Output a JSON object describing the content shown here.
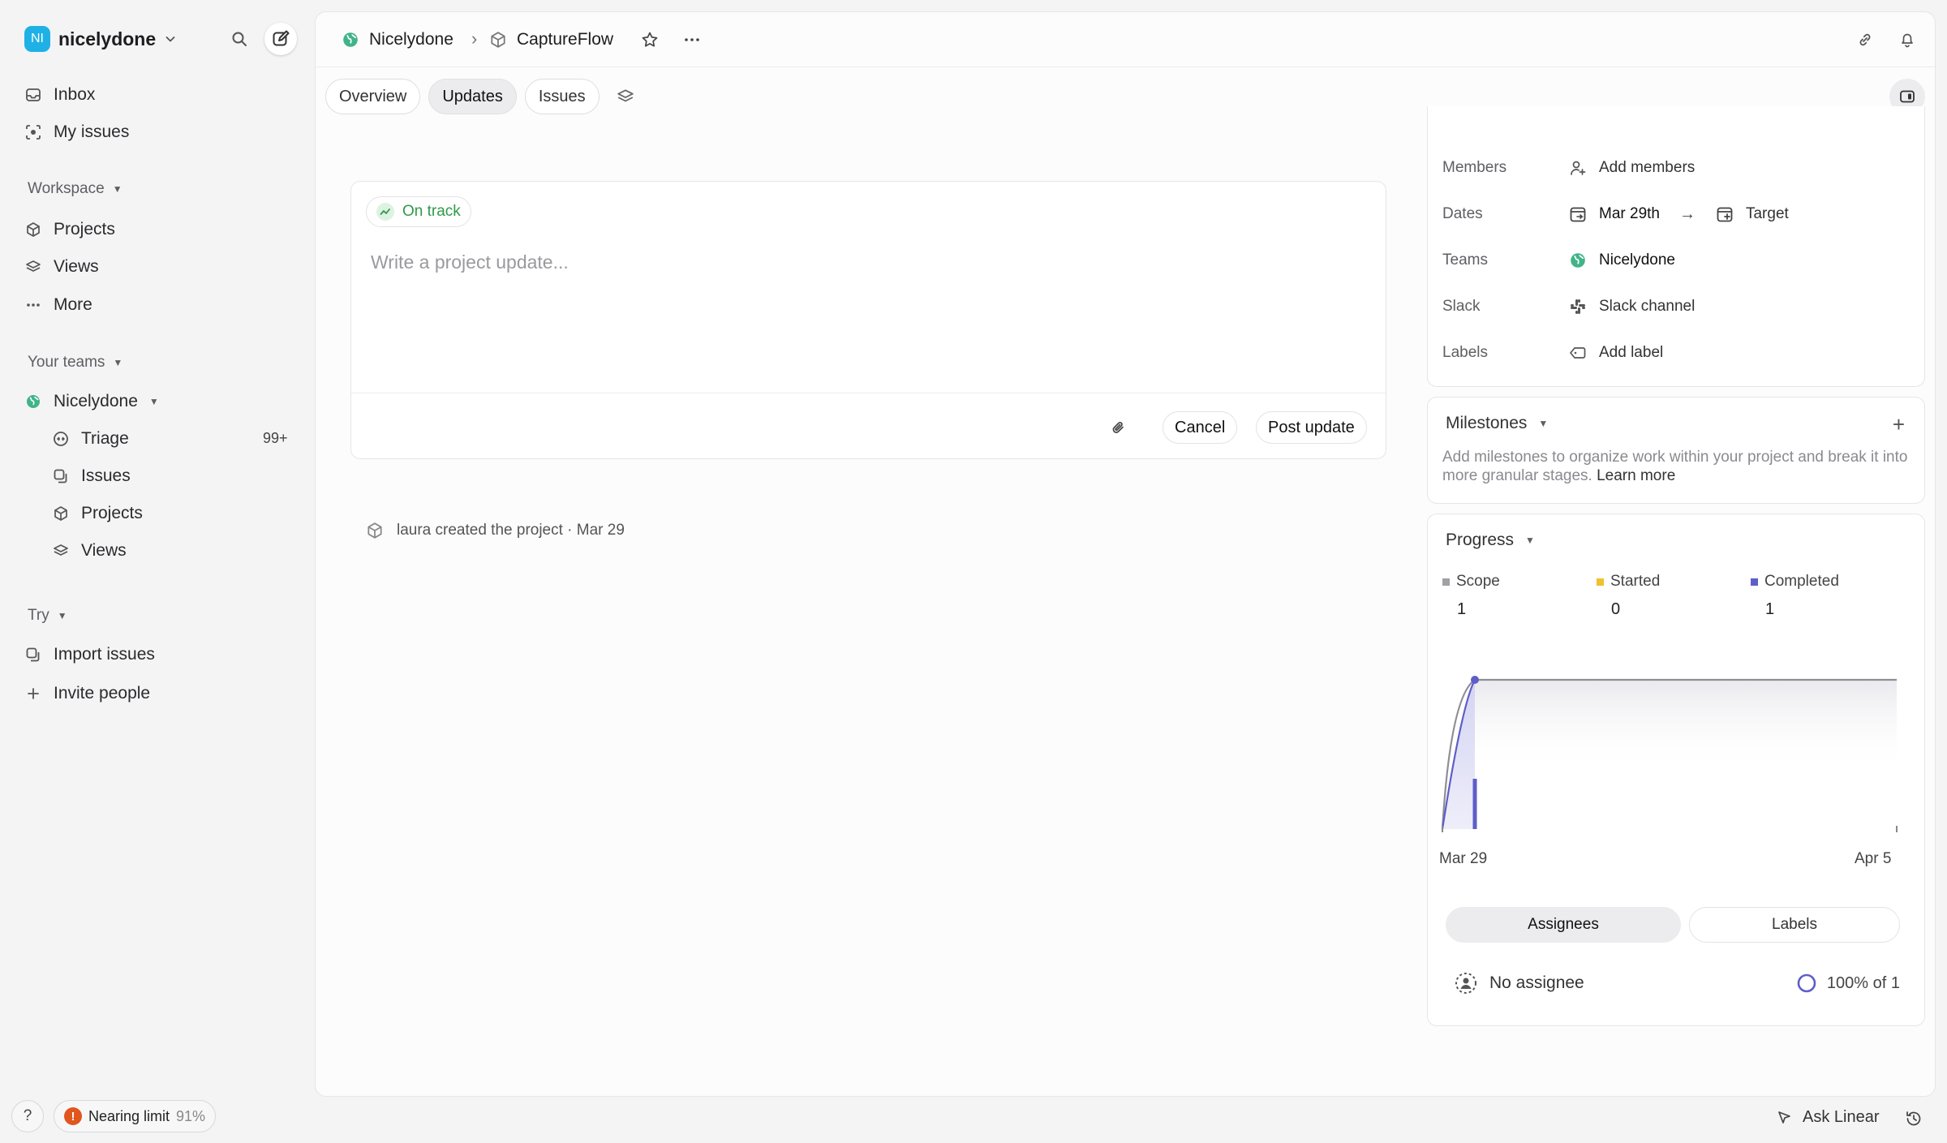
{
  "workspace": {
    "initials": "NI",
    "name": "nicelydone"
  },
  "sidebar": {
    "top": [
      {
        "label": "Inbox",
        "icon": "inbox-icon"
      },
      {
        "label": "My issues",
        "icon": "my-issues-icon"
      }
    ],
    "workspace_header": "Workspace",
    "workspace_items": [
      {
        "label": "Projects",
        "icon": "cube-icon"
      },
      {
        "label": "Views",
        "icon": "layers-icon"
      },
      {
        "label": "More",
        "icon": "ellipsis-icon"
      }
    ],
    "teams_header": "Your teams",
    "team": {
      "label": "Nicelydone"
    },
    "team_items": [
      {
        "label": "Triage",
        "icon": "triage-icon",
        "count": "99+"
      },
      {
        "label": "Issues",
        "icon": "issues-icon"
      },
      {
        "label": "Projects",
        "icon": "cube-icon"
      },
      {
        "label": "Views",
        "icon": "layers-icon"
      }
    ],
    "try_header": "Try",
    "try_items": [
      {
        "label": "Import issues",
        "icon": "import-icon"
      },
      {
        "label": "Invite people",
        "icon": "plus-icon"
      }
    ],
    "help": "?",
    "limit": {
      "label": "Nearing limit",
      "percent": "91%"
    }
  },
  "header": {
    "team": "Nicelydone",
    "separator": "›",
    "project": "CaptureFlow"
  },
  "tabs": [
    "Overview",
    "Updates",
    "Issues"
  ],
  "composer": {
    "status": "On track",
    "placeholder": "Write a project update...",
    "cancel": "Cancel",
    "post": "Post update"
  },
  "activity": {
    "text": "laura created the project · Mar 29"
  },
  "properties": {
    "members": {
      "label": "Members",
      "value": "Add members"
    },
    "dates": {
      "label": "Dates",
      "start": "Mar 29th",
      "target": "Target"
    },
    "teams": {
      "label": "Teams",
      "value": "Nicelydone"
    },
    "slack": {
      "label": "Slack",
      "value": "Slack channel"
    },
    "labels": {
      "label": "Labels",
      "value": "Add label"
    }
  },
  "milestones": {
    "title": "Milestones",
    "desc": "Add milestones to organize work within your project and break it into more granular stages.",
    "link": "Learn more"
  },
  "progress": {
    "title": "Progress",
    "legend": [
      {
        "name": "Scope",
        "value": "1",
        "color": "#a0a0a5"
      },
      {
        "name": "Started",
        "value": "0",
        "color": "#f0c02f"
      },
      {
        "name": "Completed",
        "value": "1",
        "color": "#5e5ec9"
      }
    ],
    "segments": [
      "Assignees",
      "Labels"
    ],
    "assignee": {
      "name": "No assignee",
      "pct": "100% of 1"
    }
  },
  "chart_data": {
    "type": "line",
    "x": [
      "Mar 29",
      "Apr 5"
    ],
    "x_tick_labels": [
      "Mar 29",
      "Apr 5"
    ],
    "series": [
      {
        "name": "Scope",
        "values": [
          1,
          1
        ]
      },
      {
        "name": "Completed",
        "values": [
          1,
          1
        ]
      }
    ],
    "ylim": [
      0,
      1
    ]
  },
  "footer": {
    "ask": "Ask Linear"
  },
  "colors": {
    "accent": "#5e5ec9",
    "on_track": "#2f9a4a",
    "warning": "#e0561d",
    "workspace": "#1fb1e6"
  }
}
